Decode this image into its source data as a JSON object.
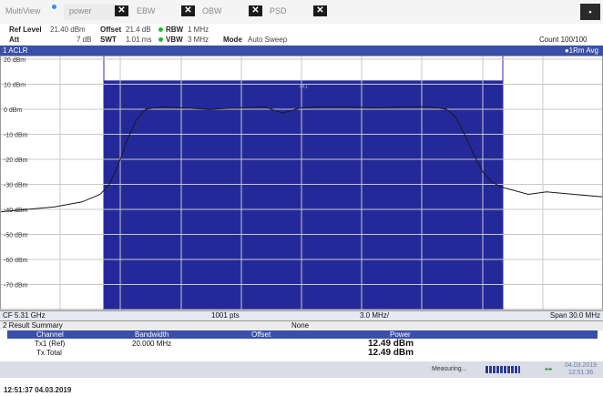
{
  "tabs": [
    {
      "label": "MultiView",
      "active": false
    },
    {
      "label": "power",
      "active": true
    },
    {
      "label": "EBW",
      "active": false
    },
    {
      "label": "OBW",
      "active": false
    },
    {
      "label": "PSD",
      "active": false
    }
  ],
  "settings": {
    "ref_level_label": "Ref Level",
    "ref_level_value": "21.40 dBm",
    "offset_label": "Offset",
    "offset_value": "21.4 dB",
    "rbw_label": "RBW",
    "rbw_value": "1 MHz",
    "att_label": "Att",
    "att_value": "7 dB",
    "swt_label": "SWT",
    "swt_value": "1.01 ms",
    "vbw_label": "VBW",
    "vbw_value": "3 MHz",
    "mode_label": "Mode",
    "mode_value": "Auto Sweep",
    "count": "Count 100/100"
  },
  "window": {
    "title": "1 ACLR",
    "trace": "●1Rm Avg"
  },
  "chart_data": {
    "type": "line",
    "ylabels": [
      "20 dBm",
      "10 dBm",
      "0 dBm",
      "-10 dBm",
      "-20 dBm",
      "-30 dBm",
      "-40 dBm",
      "-50 dBm",
      "-60 dBm",
      "-70 dBm"
    ],
    "ylim": [
      -80,
      20
    ],
    "channel_label": "Tx1",
    "channel_bar_level": 11.5,
    "trace": {
      "x": [
        0,
        30,
        60,
        90,
        110,
        120,
        130,
        140,
        150,
        160,
        180,
        200,
        230,
        260,
        290,
        310,
        330,
        350,
        380,
        410,
        440,
        470,
        490,
        500,
        510,
        520,
        530,
        540,
        550,
        560,
        580,
        600,
        630,
        662
      ],
      "y": [
        -41,
        -40,
        -39,
        -37,
        -34,
        -30,
        -22,
        -12,
        -4,
        0,
        1,
        0.5,
        0,
        0.5,
        1,
        -1.5,
        0.5,
        1,
        1,
        0.5,
        1,
        1,
        0,
        -3,
        -10,
        -18,
        -25,
        -29,
        -31,
        -32,
        -34,
        -33,
        -34,
        -35
      ]
    },
    "grid": true
  },
  "bottombar": {
    "cf": "CF 5.31 GHz",
    "pts": "1001 pts",
    "div": "3.0 MHz/",
    "span": "Span 30.0 MHz"
  },
  "result_summary": {
    "title": "2 Result Summary",
    "center": "None",
    "headers": [
      "Channel",
      "Bandwidth",
      "Offset",
      "Power"
    ],
    "rows": [
      {
        "channel": "Tx1 (Ref)",
        "bandwidth": "20.000 MHz",
        "offset": "",
        "power": "12.49 dBm"
      },
      {
        "channel": "Tx Total",
        "bandwidth": "",
        "offset": "",
        "power": "12.49 dBm"
      }
    ]
  },
  "status": {
    "measuring": "Measuring...",
    "date": "04.03.2019",
    "time": "12:51:36"
  },
  "footer": "12:51:37  04.03.2019"
}
